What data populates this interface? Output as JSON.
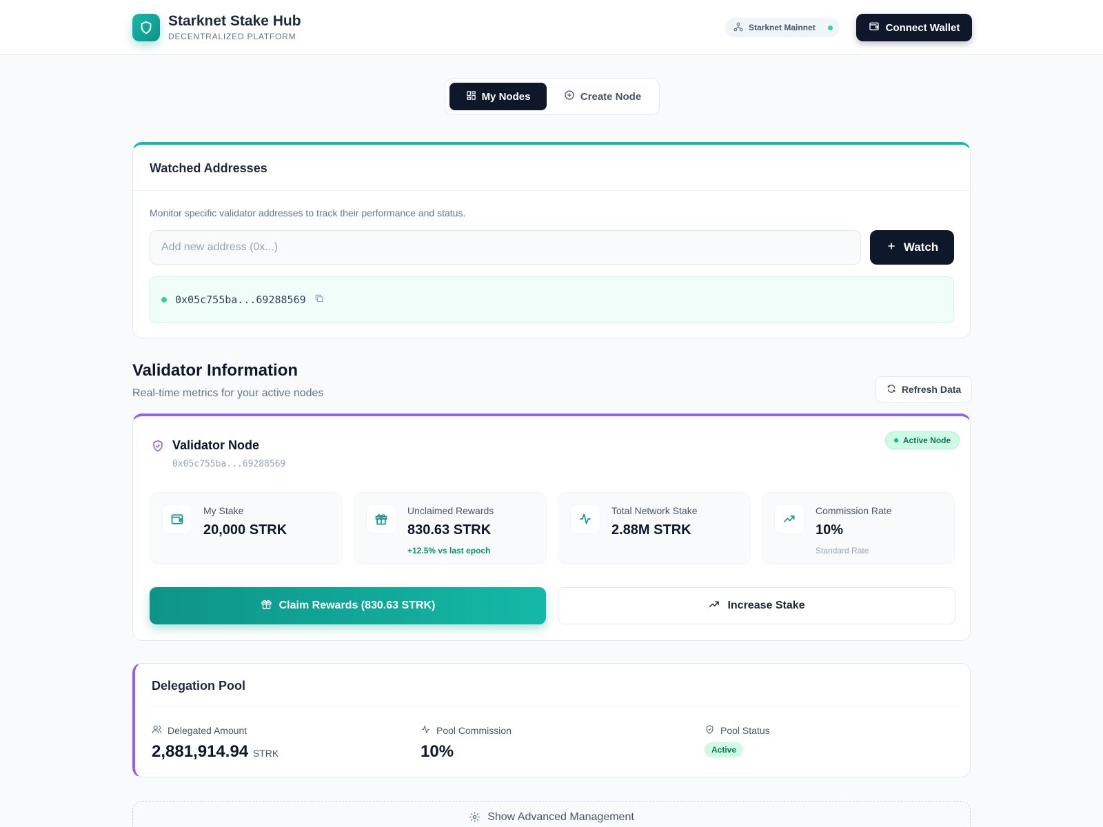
{
  "header": {
    "title": "Starknet Stake Hub",
    "subtitle": "DECENTRALIZED PLATFORM",
    "network": "Starknet Mainnet",
    "connect_label": "Connect Wallet"
  },
  "tabs": [
    {
      "label": "My Nodes",
      "active": true
    },
    {
      "label": "Create Node",
      "active": false
    }
  ],
  "watched": {
    "title": "Watched Addresses",
    "description": "Monitor specific validator addresses to track their performance and status.",
    "input_placeholder": "Add new address (0x...)",
    "watch_label": "Watch",
    "addresses": [
      "0x05c755ba...69288569"
    ]
  },
  "validator_section": {
    "title": "Validator Information",
    "subtitle": "Real-time metrics for your active nodes",
    "refresh_label": "Refresh Data"
  },
  "node": {
    "title": "Validator Node",
    "address": "0x05c755ba...69288569",
    "status": "Active Node",
    "stats": [
      {
        "label": "My Stake",
        "value": "20,000 STRK",
        "note": ""
      },
      {
        "label": "Unclaimed Rewards",
        "value": "830.63 STRK",
        "note": "+12.5% vs last epoch"
      },
      {
        "label": "Total Network Stake",
        "value": "2.88M STRK",
        "note": ""
      },
      {
        "label": "Commission Rate",
        "value": "10%",
        "note": "Standard Rate"
      }
    ],
    "claim_label": "Claim Rewards (830.63 STRK)",
    "increase_label": "Increase Stake"
  },
  "pool": {
    "title": "Delegation Pool",
    "delegated_label": "Delegated Amount",
    "delegated_value": "2,881,914.94",
    "delegated_unit": "STRK",
    "commission_label": "Pool Commission",
    "commission_value": "10%",
    "status_label": "Pool Status",
    "status_value": "Active"
  },
  "advanced_label": "Show Advanced Management",
  "colors": {
    "accent_teal": "#14b8a6",
    "accent_purple": "#9061f9",
    "dark": "#0f172a",
    "success": "#10b981"
  }
}
